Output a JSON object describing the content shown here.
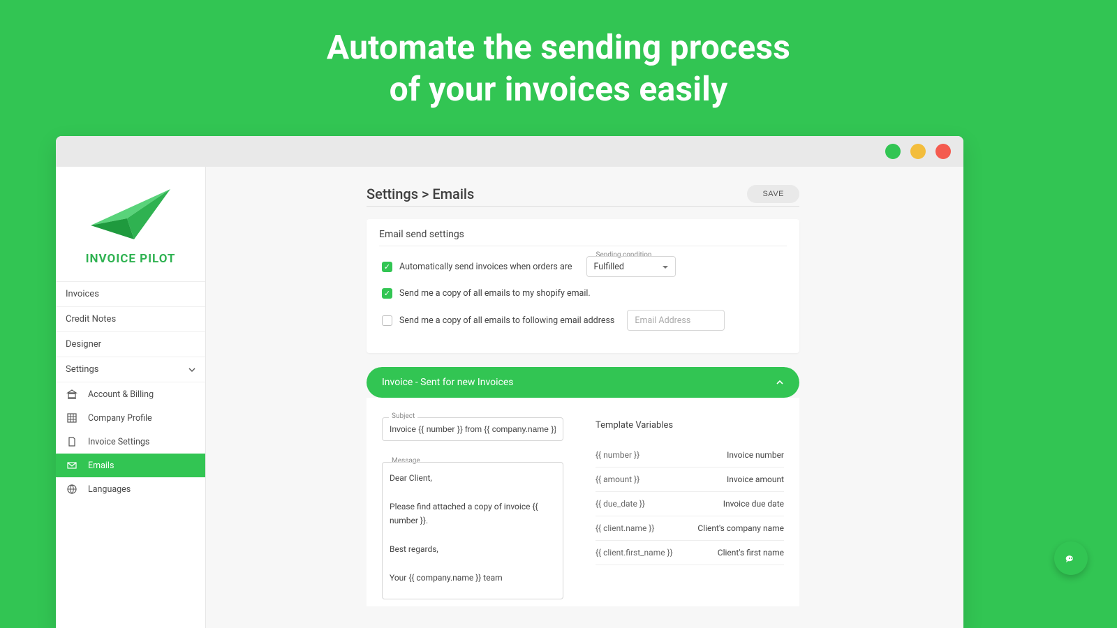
{
  "hero": {
    "line1": "Automate the sending process",
    "line2": "of your invoices easily"
  },
  "brand": {
    "name": "INVOICE PILOT"
  },
  "sidebar": {
    "items": [
      {
        "label": "Invoices"
      },
      {
        "label": "Credit Notes"
      },
      {
        "label": "Designer"
      },
      {
        "label": "Settings"
      }
    ],
    "settings_children": [
      {
        "label": "Account & Billing",
        "icon": "bank-icon"
      },
      {
        "label": "Company Profile",
        "icon": "grid-icon"
      },
      {
        "label": "Invoice Settings",
        "icon": "file-icon"
      },
      {
        "label": "Emails",
        "icon": "mail-icon"
      },
      {
        "label": "Languages",
        "icon": "globe-icon"
      }
    ]
  },
  "page": {
    "breadcrumb": "Settings > Emails",
    "save_label": "SAVE"
  },
  "email_settings": {
    "title": "Email send settings",
    "row1_label": "Automatically send invoices when orders are",
    "sending_condition_label": "Sending condition",
    "sending_condition_value": "Fulfilled",
    "row2_label": "Send me a copy of all emails to my shopify email.",
    "row3_label": "Send me a copy of all emails to following email address",
    "email_placeholder": "Email Address"
  },
  "template": {
    "accordion_title": "Invoice - Sent for new Invoices",
    "subject_label": "Subject",
    "subject_value": "Invoice {{ number }} from {{ company.name }}",
    "message_label": "Message",
    "message_body": "Dear Client,\n\nPlease find attached a copy of invoice {{ number }}.\n\nBest regards,\n\nYour {{ company.name }} team",
    "vars_title": "Template Variables",
    "vars": [
      {
        "token": "{{ number }}",
        "desc": "Invoice number"
      },
      {
        "token": "{{ amount }}",
        "desc": "Invoice amount"
      },
      {
        "token": "{{ due_date }}",
        "desc": "Invoice due date"
      },
      {
        "token": "{{ client.name }}",
        "desc": "Client's company name"
      },
      {
        "token": "{{ client.first_name }}",
        "desc": "Client's first name"
      }
    ]
  }
}
